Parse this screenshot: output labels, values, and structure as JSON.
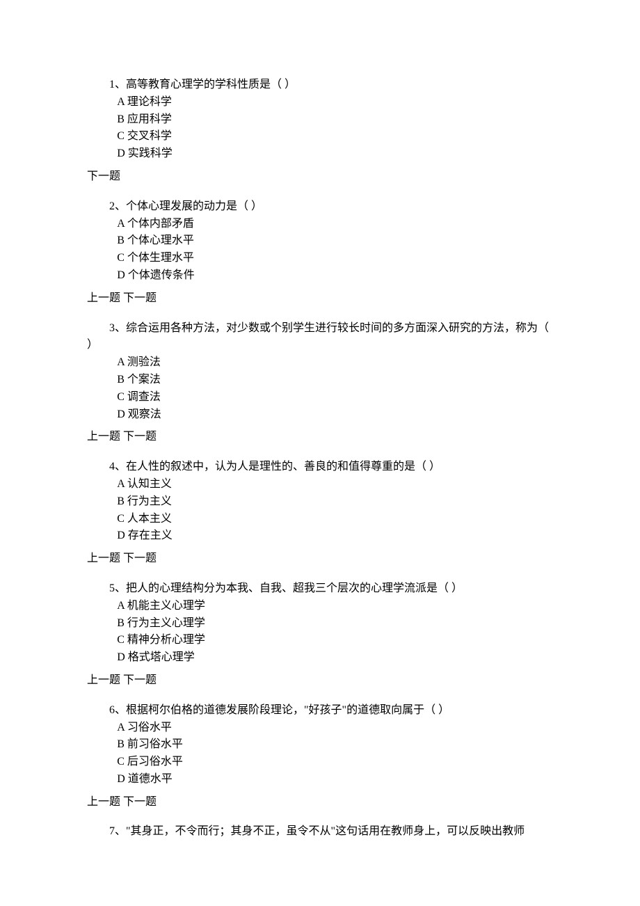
{
  "nav": {
    "prev": "上一题",
    "next": "下一题"
  },
  "questions": [
    {
      "stem": "1、高等教育心理学的学科性质是（ ）",
      "options": [
        "A 理论科学",
        "B 应用科学",
        "C 交叉科学",
        "D 实践科学"
      ],
      "show_prev": false
    },
    {
      "stem": "2、个体心理发展的动力是（ ）",
      "options": [
        "A 个体内部矛盾",
        "B 个体心理水平",
        "C 个体生理水平",
        "D 个体遗传条件"
      ],
      "show_prev": true
    },
    {
      "stem": "3、综合运用各种方法，对少数或个别学生进行较长时间的多方面深入研究的方法，称为（ ）",
      "options": [
        "A 测验法",
        "B 个案法",
        "C 调查法",
        "D 观察法"
      ],
      "show_prev": true
    },
    {
      "stem": "4、在人性的叙述中，认为人是理性的、善良的和值得尊重的是（ ）",
      "options": [
        "A 认知主义",
        "B 行为主义",
        "C 人本主义",
        "D 存在主义"
      ],
      "show_prev": true
    },
    {
      "stem": "5、把人的心理结构分为本我、自我、超我三个层次的心理学流派是（ ）",
      "options": [
        "A 机能主义心理学",
        "B 行为主义心理学",
        "C 精神分析心理学",
        "D 格式塔心理学"
      ],
      "show_prev": true
    },
    {
      "stem": "6、根据柯尔伯格的道德发展阶段理论，\"好孩子\"的道德取向属于（ ）",
      "options": [
        "A 习俗水平",
        "B 前习俗水平",
        "C 后习俗水平",
        "D 道德水平"
      ],
      "show_prev": true
    },
    {
      "stem": "7、\"其身正，不令而行；其身不正，虽令不从\"这句话用在教师身上，可以反映出教师",
      "options": [],
      "show_prev": null
    }
  ]
}
